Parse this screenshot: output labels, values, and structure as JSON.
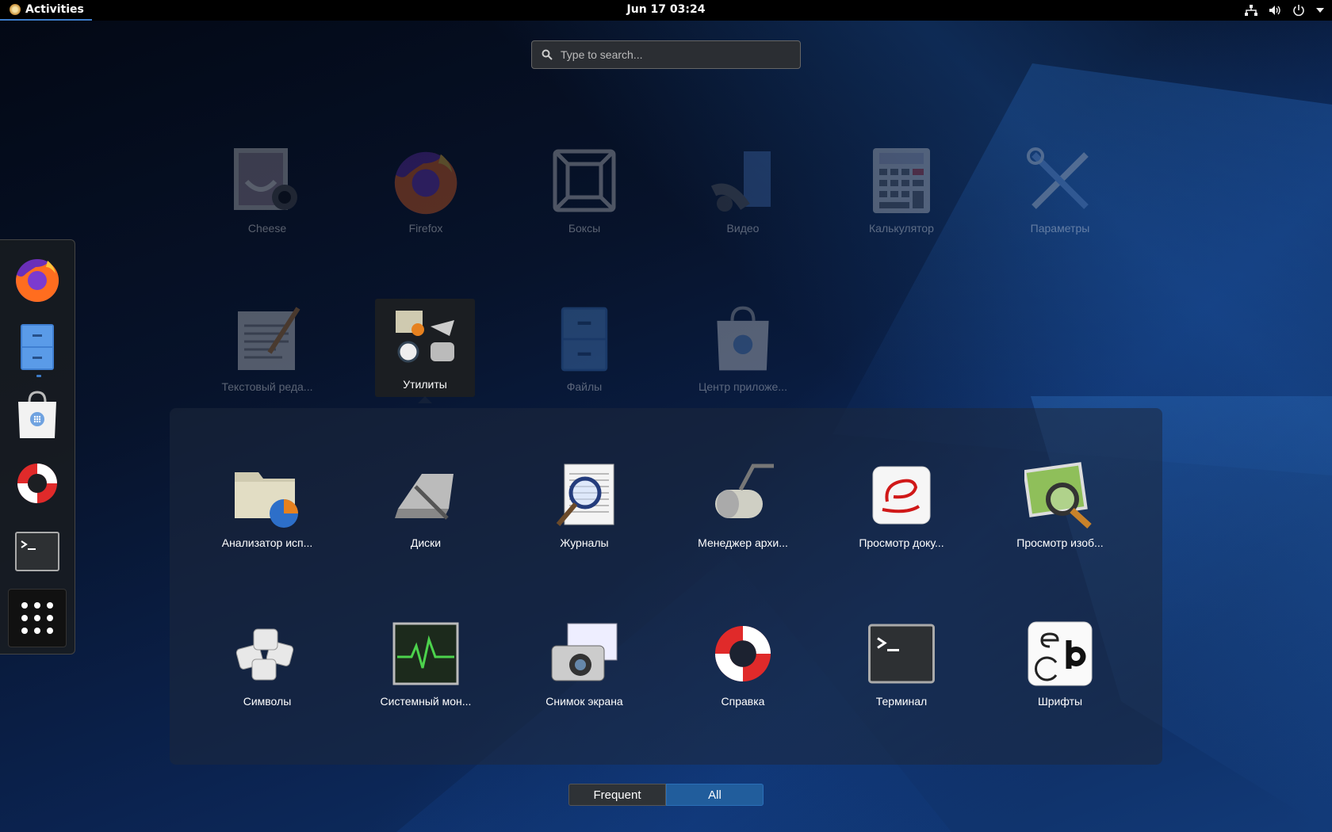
{
  "topbar": {
    "activities_label": "Activities",
    "clock": "Jun 17  03:24"
  },
  "search": {
    "placeholder": "Type to search..."
  },
  "dash": {
    "items": [
      "firefox-icon",
      "files-icon",
      "software-bag-icon",
      "help-lifebuoy-icon",
      "terminal-icon",
      "show-apps-grid-icon"
    ]
  },
  "apps": {
    "row1": [
      {
        "label": "Cheese"
      },
      {
        "label": "Firefox"
      },
      {
        "label": "Боксы"
      },
      {
        "label": "Видео"
      },
      {
        "label": "Калькулятор"
      },
      {
        "label": "Параметры"
      }
    ],
    "row2": [
      {
        "label": "Текстовый реда..."
      },
      {
        "label": "Утилиты"
      },
      {
        "label": "Файлы"
      },
      {
        "label": "Центр приложе..."
      }
    ]
  },
  "folder": {
    "row1": [
      {
        "label": "Анализатор исп..."
      },
      {
        "label": "Диски"
      },
      {
        "label": "Журналы"
      },
      {
        "label": "Менеджер архи..."
      },
      {
        "label": "Просмотр доку..."
      },
      {
        "label": "Просмотр изоб..."
      }
    ],
    "row2": [
      {
        "label": "Символы"
      },
      {
        "label": "Системный мон..."
      },
      {
        "label": "Снимок экрана"
      },
      {
        "label": "Справка"
      },
      {
        "label": "Терминал"
      },
      {
        "label": "Шрифты"
      }
    ]
  },
  "view_switch": {
    "frequent": "Frequent",
    "all": "All",
    "selected": "All"
  },
  "colors": {
    "accent": "#215d9c",
    "topbar": "#000000"
  }
}
